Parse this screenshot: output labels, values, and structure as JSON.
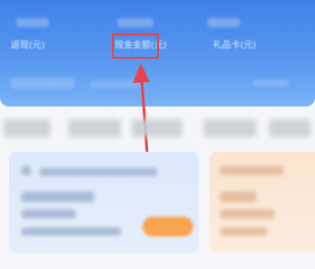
{
  "summary_stats": [
    {
      "label": "返现(元)"
    },
    {
      "label": "现金金额(元)"
    },
    {
      "label": "礼品卡(元)"
    }
  ],
  "colors": {
    "header_blue": "#4a8aec",
    "highlight_red": "#e8434a",
    "card_blue": "#dbe8fb",
    "card_orange": "#fbe3cf",
    "button_orange": "#f7a34f"
  },
  "icons": [
    "up-arrow-icon"
  ]
}
